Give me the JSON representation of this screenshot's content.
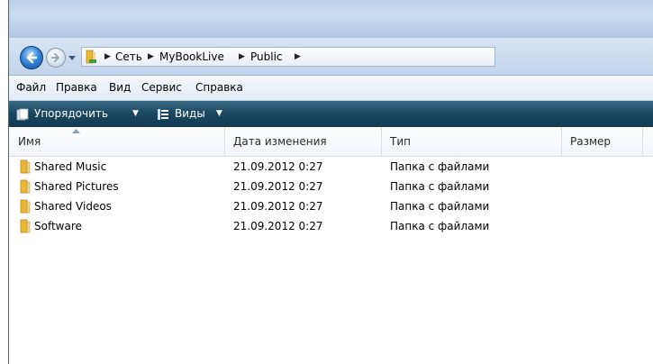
{
  "breadcrumb": {
    "segments": [
      "Сеть",
      "MyBookLive",
      "Public"
    ],
    "separator": "▶"
  },
  "menu": {
    "items": [
      "Файл",
      "Правка",
      "Вид",
      "Сервис",
      "Справка"
    ]
  },
  "commandbar": {
    "organize_label": "Упорядочить",
    "views_label": "Виды",
    "caret": "▼"
  },
  "columns": {
    "name": "Имя",
    "date": "Дата изменения",
    "type": "Тип",
    "size": "Размер"
  },
  "files": [
    {
      "name": "Shared Music",
      "date": "21.09.2012 0:27",
      "type": "Папка с файлами",
      "size": ""
    },
    {
      "name": "Shared Pictures",
      "date": "21.09.2012 0:27",
      "type": "Папка с файлами",
      "size": ""
    },
    {
      "name": "Shared Videos",
      "date": "21.09.2012 0:27",
      "type": "Папка с файлами",
      "size": ""
    },
    {
      "name": "Software",
      "date": "21.09.2012 0:27",
      "type": "Папка с файлами",
      "size": ""
    }
  ],
  "icons": {
    "back": "back-arrow-icon",
    "forward": "forward-arrow-icon",
    "recent": "dropdown-arrow-icon",
    "folder": "folder-icon",
    "organize": "organize-icon",
    "views": "views-icon",
    "sort": "sort-ascending-icon"
  },
  "colors": {
    "commandbar": "#1d4861",
    "folder": "#e9b73c",
    "back_button": "#3a86d6"
  }
}
